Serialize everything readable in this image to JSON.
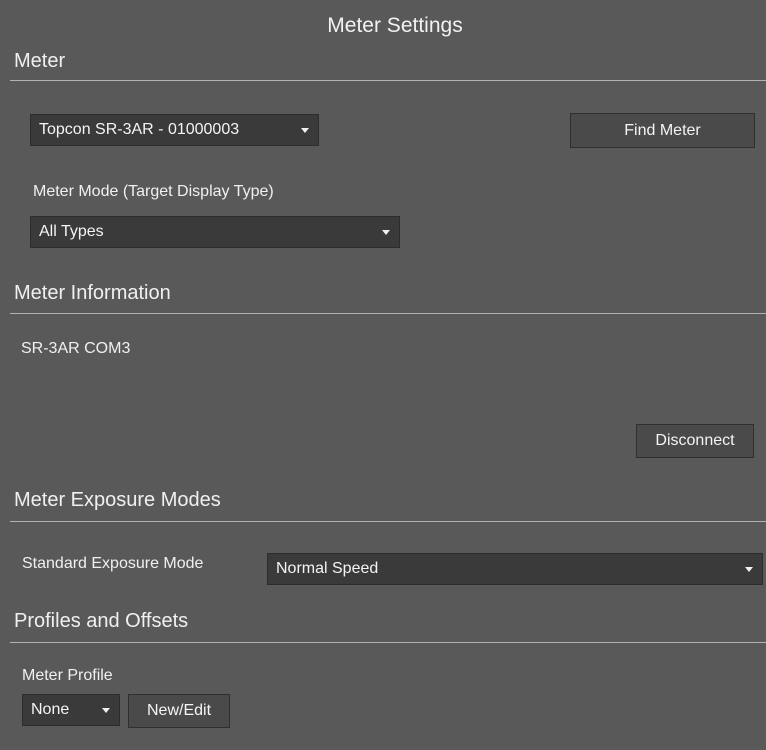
{
  "title": "Meter Settings",
  "meter": {
    "header": "Meter",
    "selected_meter": "Topcon SR-3AR - 01000003",
    "find_button": "Find Meter",
    "mode_label": "Meter Mode (Target Display Type)",
    "mode_value": "All Types"
  },
  "info": {
    "header": "Meter Information",
    "device_text": "SR-3AR COM3",
    "disconnect_button": "Disconnect"
  },
  "exposure": {
    "header": "Meter Exposure Modes",
    "standard_label": "Standard Exposure Mode",
    "standard_value": "Normal Speed"
  },
  "profiles": {
    "header": "Profiles and Offsets",
    "profile_label": "Meter Profile",
    "profile_value": "None",
    "new_edit_button": "New/Edit"
  },
  "colors": {
    "background": "#595959",
    "control": "#3a3a3a",
    "button": "#4a4a4a",
    "text": "#f0f0f0"
  },
  "icons": [
    "dropdown-arrow-icon"
  ]
}
